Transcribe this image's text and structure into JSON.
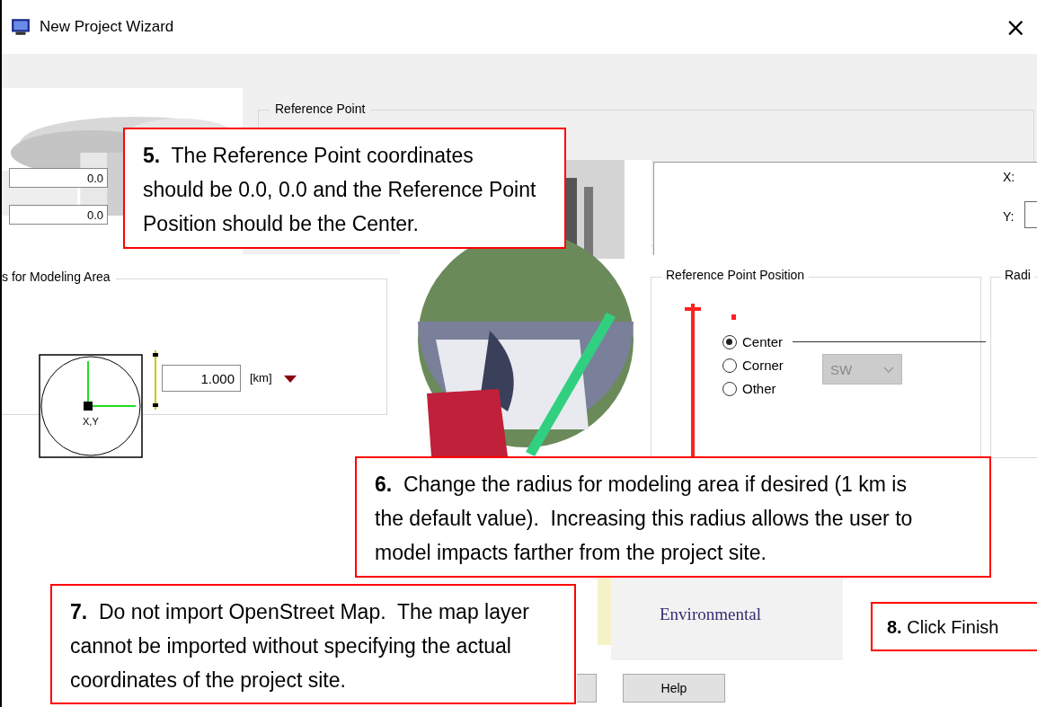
{
  "window": {
    "title": "New Project Wizard",
    "close": "×"
  },
  "left_fields": [
    "0.0",
    "0.0"
  ],
  "reference_point": {
    "title": "Reference Point",
    "x_label": "X:",
    "y_label": "Y:"
  },
  "modeling_area": {
    "title": "s for Modeling Area",
    "xy_label": "X,Y",
    "radius": "1.000",
    "unit": "[km]"
  },
  "reference_point_position": {
    "title": "Reference Point Position",
    "options": [
      {
        "label": "Center",
        "selected": true
      },
      {
        "label": "Corner",
        "selected": false
      },
      {
        "label": "Other",
        "selected": false
      }
    ],
    "dropdown": {
      "value": "SW",
      "disabled": true
    }
  },
  "radius_group": {
    "title": "Radi"
  },
  "logo": {
    "text": "Environmental"
  },
  "buttons": [
    "Help"
  ],
  "callouts": [
    {
      "text": "**5.**  The Reference Point coordinates should be 0.0, 0.0 and the Reference Point Position should be the Center."
    },
    {
      "text": "**6.**  Change the radius for modeling area if desired (1 km is the default value).  Increasing this radius allows the user to model impacts farther from the project site."
    },
    {
      "text": "**7.**  Do not import OpenStreet Map.  The map layer cannot be imported without specifying the actual coordinates of the project site."
    },
    {
      "text": "**8.**  Click Finish"
    }
  ]
}
